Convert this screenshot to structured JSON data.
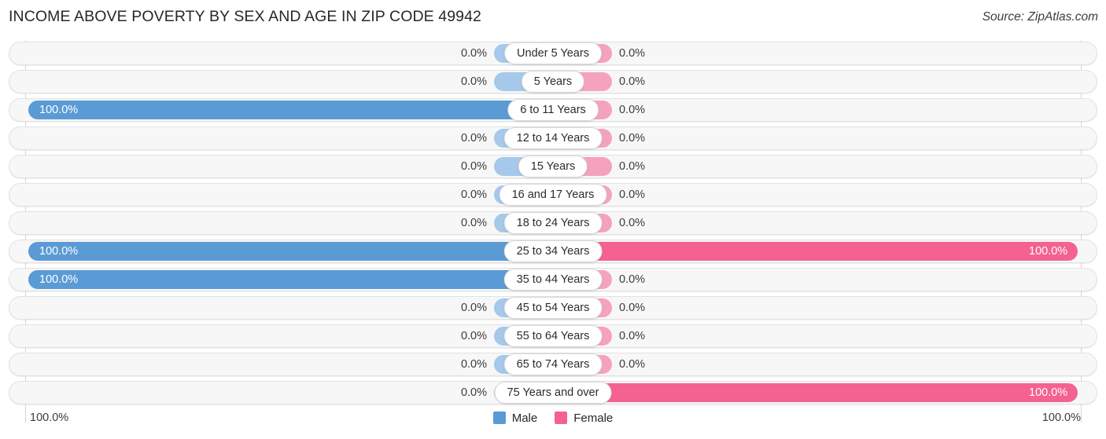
{
  "header": {
    "title": "INCOME ABOVE POVERTY BY SEX AND AGE IN ZIP CODE 49942",
    "source": "Source: ZipAtlas.com"
  },
  "axis": {
    "left_label": "100.0%",
    "right_label": "100.0%"
  },
  "legend": {
    "male_label": "Male",
    "female_label": "Female",
    "male_color": "#5B9BD5",
    "female_color": "#F4628F"
  },
  "colors": {
    "male": "#5B9BD5",
    "male_zero": "#A6C8EA",
    "female": "#F4628F",
    "female_zero": "#F5A2BF",
    "track": "#F7F7F7",
    "track_border": "#E2E2E2",
    "gridline": "#D6D6D6"
  },
  "chart_data": {
    "type": "bar",
    "subtype": "diverging-horizontal-bar",
    "title": "INCOME ABOVE POVERTY BY SEX AND AGE IN ZIP CODE 49942",
    "xlabel": "",
    "ylabel": "",
    "xlim": [
      0,
      100
    ],
    "grid": true,
    "legend_position": "bottom-center",
    "axis_left_max": "100.0%",
    "axis_right_max": "100.0%",
    "categories": [
      "Under 5 Years",
      "5 Years",
      "6 to 11 Years",
      "12 to 14 Years",
      "15 Years",
      "16 and 17 Years",
      "18 to 24 Years",
      "25 to 34 Years",
      "35 to 44 Years",
      "45 to 54 Years",
      "55 to 64 Years",
      "65 to 74 Years",
      "75 Years and over"
    ],
    "series": [
      {
        "name": "Male",
        "values": [
          0.0,
          0.0,
          100.0,
          0.0,
          0.0,
          0.0,
          0.0,
          100.0,
          100.0,
          0.0,
          0.0,
          0.0,
          0.0
        ]
      },
      {
        "name": "Female",
        "values": [
          0.0,
          0.0,
          0.0,
          0.0,
          0.0,
          0.0,
          0.0,
          100.0,
          0.0,
          0.0,
          0.0,
          0.0,
          100.0
        ]
      }
    ]
  },
  "rows": [
    {
      "label": "Under 5 Years",
      "male": 0.0,
      "male_text": "0.0%",
      "female": 0.0,
      "female_text": "0.0%"
    },
    {
      "label": "5 Years",
      "male": 0.0,
      "male_text": "0.0%",
      "female": 0.0,
      "female_text": "0.0%"
    },
    {
      "label": "6 to 11 Years",
      "male": 100.0,
      "male_text": "100.0%",
      "female": 0.0,
      "female_text": "0.0%"
    },
    {
      "label": "12 to 14 Years",
      "male": 0.0,
      "male_text": "0.0%",
      "female": 0.0,
      "female_text": "0.0%"
    },
    {
      "label": "15 Years",
      "male": 0.0,
      "male_text": "0.0%",
      "female": 0.0,
      "female_text": "0.0%"
    },
    {
      "label": "16 and 17 Years",
      "male": 0.0,
      "male_text": "0.0%",
      "female": 0.0,
      "female_text": "0.0%"
    },
    {
      "label": "18 to 24 Years",
      "male": 0.0,
      "male_text": "0.0%",
      "female": 0.0,
      "female_text": "0.0%"
    },
    {
      "label": "25 to 34 Years",
      "male": 100.0,
      "male_text": "100.0%",
      "female": 100.0,
      "female_text": "100.0%"
    },
    {
      "label": "35 to 44 Years",
      "male": 100.0,
      "male_text": "100.0%",
      "female": 0.0,
      "female_text": "0.0%"
    },
    {
      "label": "45 to 54 Years",
      "male": 0.0,
      "male_text": "0.0%",
      "female": 0.0,
      "female_text": "0.0%"
    },
    {
      "label": "55 to 64 Years",
      "male": 0.0,
      "male_text": "0.0%",
      "female": 0.0,
      "female_text": "0.0%"
    },
    {
      "label": "65 to 74 Years",
      "male": 0.0,
      "male_text": "0.0%",
      "female": 0.0,
      "female_text": "0.0%"
    },
    {
      "label": "75 Years and over",
      "male": 0.0,
      "male_text": "0.0%",
      "female": 100.0,
      "female_text": "100.0%"
    }
  ]
}
